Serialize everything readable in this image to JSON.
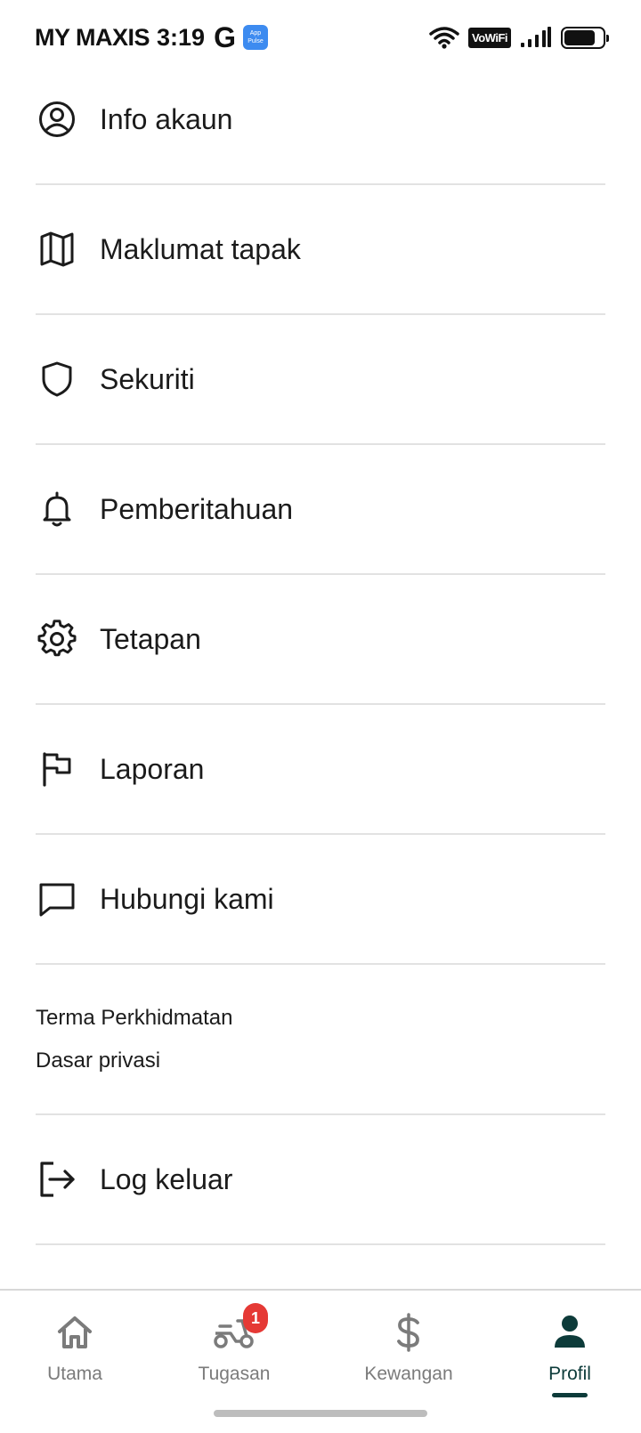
{
  "status_bar": {
    "carrier": "MY MAXIS",
    "time": "3:19",
    "google": "G",
    "app_badge_line1": "App",
    "app_badge_line2": "Pulse",
    "vowifi": "VoWiFi",
    "icons": [
      "wifi-icon",
      "signal-icon",
      "battery-icon"
    ]
  },
  "menu": {
    "items": [
      {
        "label": "Info akaun",
        "icon": "account-circle-icon"
      },
      {
        "label": "Maklumat tapak",
        "icon": "map-icon"
      },
      {
        "label": "Sekuriti",
        "icon": "shield-icon"
      },
      {
        "label": "Pemberitahuan",
        "icon": "bell-icon"
      },
      {
        "label": "Tetapan",
        "icon": "gear-icon"
      },
      {
        "label": "Laporan",
        "icon": "flag-icon"
      },
      {
        "label": "Hubungi kami",
        "icon": "chat-icon"
      }
    ]
  },
  "legal": {
    "terms": "Terma Perkhidmatan",
    "privacy": "Dasar privasi"
  },
  "logout": {
    "label": "Log keluar",
    "icon": "logout-icon"
  },
  "bottom_nav": {
    "items": [
      {
        "label": "Utama",
        "icon": "home-icon"
      },
      {
        "label": "Tugasan",
        "icon": "scooter-icon",
        "badge": "1"
      },
      {
        "label": "Kewangan",
        "icon": "dollar-icon"
      },
      {
        "label": "Profil",
        "icon": "person-icon",
        "active": true
      }
    ],
    "accent_color": "#0d3b3a",
    "inactive_color": "#7b7b7b",
    "badge_color": "#e53935"
  }
}
